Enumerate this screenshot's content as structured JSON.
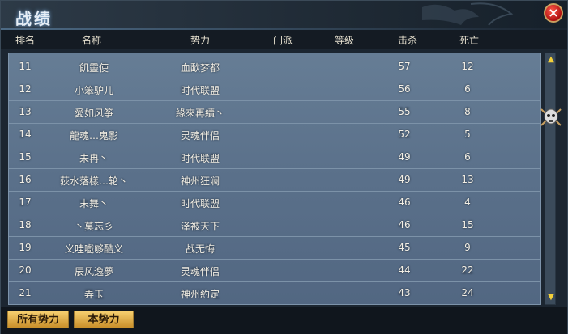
{
  "window": {
    "title": "战绩"
  },
  "columns": [
    "排名",
    "名称",
    "势力",
    "门派",
    "等级",
    "击杀",
    "死亡"
  ],
  "rows": [
    {
      "rank": "11",
      "name": "飢靈使",
      "faction": "血歃梦都",
      "sect": "",
      "level": "",
      "kills": "57",
      "deaths": "12"
    },
    {
      "rank": "12",
      "name": "小笨驴儿",
      "faction": "时代联盟",
      "sect": "",
      "level": "",
      "kills": "56",
      "deaths": "6"
    },
    {
      "rank": "13",
      "name": "愛如风筝",
      "faction": "緣來再續丶",
      "sect": "",
      "level": "",
      "kills": "55",
      "deaths": "8"
    },
    {
      "rank": "14",
      "name": "龍魂…鬼影",
      "faction": "灵魂伴侣",
      "sect": "",
      "level": "",
      "kills": "52",
      "deaths": "5"
    },
    {
      "rank": "15",
      "name": "未冉丶",
      "faction": "时代联盟",
      "sect": "",
      "level": "",
      "kills": "49",
      "deaths": "6"
    },
    {
      "rank": "16",
      "name": "荻水落樣…轮丶",
      "faction": "神州狂澜",
      "sect": "",
      "level": "",
      "kills": "49",
      "deaths": "13"
    },
    {
      "rank": "17",
      "name": "末舞丶",
      "faction": "时代联盟",
      "sect": "",
      "level": "",
      "kills": "46",
      "deaths": "4"
    },
    {
      "rank": "18",
      "name": "丶莫忘彡",
      "faction": "泽被天下",
      "sect": "",
      "level": "",
      "kills": "46",
      "deaths": "15"
    },
    {
      "rank": "19",
      "name": "义哇嚱够酷义",
      "faction": "战无悔",
      "sect": "",
      "level": "",
      "kills": "45",
      "deaths": "9"
    },
    {
      "rank": "20",
      "name": "辰风逸夢",
      "faction": "灵魂伴侣",
      "sect": "",
      "level": "",
      "kills": "44",
      "deaths": "22"
    },
    {
      "rank": "21",
      "name": "弄玉",
      "faction": "神州約定",
      "sect": "",
      "level": "",
      "kills": "43",
      "deaths": "24"
    }
  ],
  "buttons": {
    "all_factions": "所有势力",
    "this_faction": "本势力"
  },
  "scrollbar": {
    "up_icon": "triangle-up",
    "down_icon": "triangle-down",
    "thumb_icon": "skull-emblem"
  },
  "colors": {
    "accent": "#f3d03a",
    "list_bg": "#5a708a",
    "close": "#c01414"
  }
}
